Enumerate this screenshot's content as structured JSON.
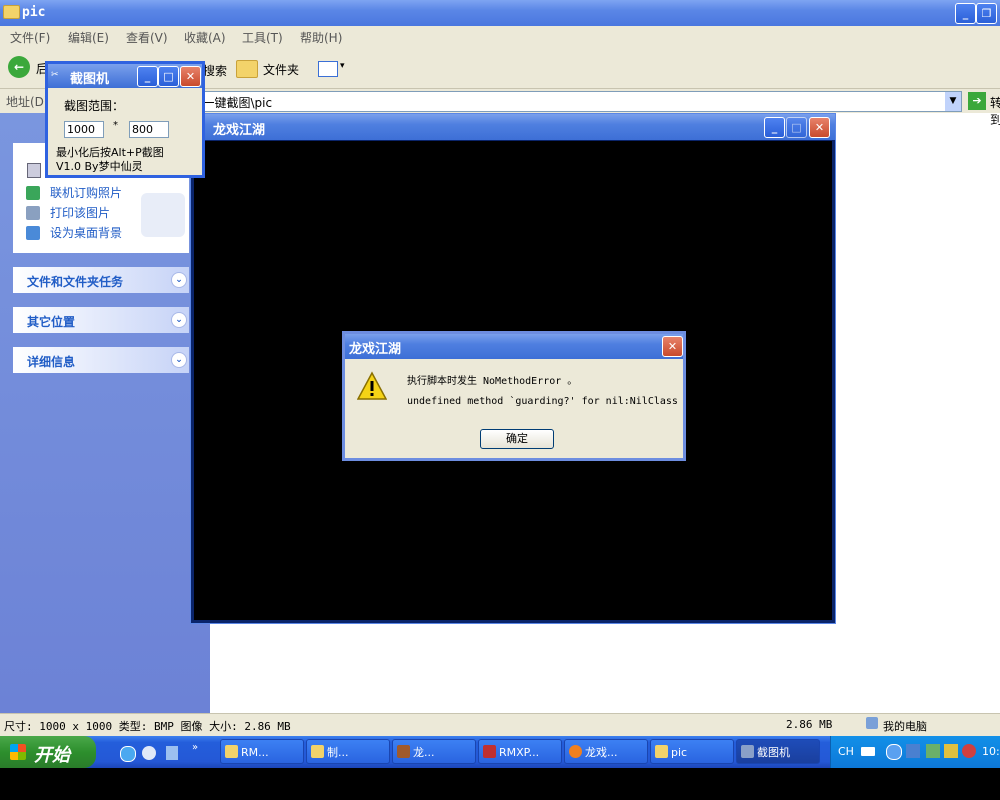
{
  "explorer": {
    "title": "pic",
    "menu": [
      "文件(F)",
      "编辑(E)",
      "查看(V)",
      "收藏(A)",
      "工具(T)",
      "帮助(H)"
    ],
    "toolbar": {
      "back_label": "后退",
      "search_label": "搜索",
      "folders_label": "文件夹"
    },
    "address": {
      "label": "地址(D)",
      "value": "...一键截图\\pic",
      "go_label": "转到"
    },
    "sidebar": {
      "picture_tasks": [
        "联机订购照片",
        "打印该图片",
        "设为桌面背景"
      ],
      "sections": [
        "文件和文件夹任务",
        "其它位置",
        "详细信息"
      ]
    },
    "status": {
      "left": "尺寸: 1000 x 1000 类型: BMP 图像 大小: 2.86 MB",
      "size": "2.86 MB",
      "location": "我的电脑"
    }
  },
  "game_window": {
    "title": "龙戏江湖"
  },
  "error_dialog": {
    "title": "龙戏江湖",
    "message_line1": "执行脚本时发生 NoMethodError 。",
    "message_line2": "undefined method `guarding?' for nil:NilClass",
    "ok_label": "确定"
  },
  "capture_tool": {
    "title": "截图机",
    "range_label": "截图范围：",
    "width_value": "1000",
    "height_value": "800",
    "separator": "*",
    "hint": "最小化后按Alt+P截图",
    "version": "V1.0 By梦中仙灵"
  },
  "taskbar": {
    "start_label": "开始",
    "tasks": [
      {
        "label": "RM...",
        "icon": "folder-icon"
      },
      {
        "label": "制...",
        "icon": "folder-icon"
      },
      {
        "label": "龙...",
        "icon": "game-icon"
      },
      {
        "label": "RMXP...",
        "icon": "rmxp-icon"
      },
      {
        "label": "龙戏...",
        "icon": "sun-icon"
      },
      {
        "label": "pic",
        "icon": "folder-icon"
      },
      {
        "label": "截图机",
        "icon": "capture-icon"
      }
    ],
    "tray": {
      "lang": "CH",
      "clock": "10:"
    }
  }
}
